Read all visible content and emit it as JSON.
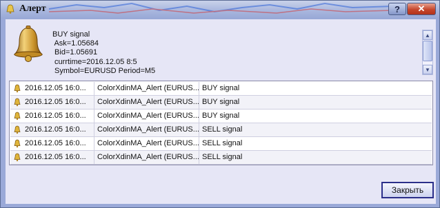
{
  "window": {
    "title": "Алерт",
    "help_label": "?",
    "close_label": "✕"
  },
  "message": {
    "text": "BUY signal\n Ask=1.05684\n Bid=1.05691\n currtime=2016.12.05 8:5\n Symbol=EURUSD Period=M5"
  },
  "alerts": [
    {
      "time": "2016.12.05 16:0...",
      "name": "ColorXdinMA_Alert (EURUS...",
      "message": "BUY signal"
    },
    {
      "time": "2016.12.05 16:0...",
      "name": "ColorXdinMA_Alert (EURUS...",
      "message": "BUY signal"
    },
    {
      "time": "2016.12.05 16:0...",
      "name": "ColorXdinMA_Alert (EURUS...",
      "message": "BUY signal"
    },
    {
      "time": "2016.12.05 16:0...",
      "name": "ColorXdinMA_Alert (EURUS...",
      "message": "SELL signal"
    },
    {
      "time": "2016.12.05 16:0...",
      "name": "ColorXdinMA_Alert (EURUS...",
      "message": "SELL signal"
    },
    {
      "time": "2016.12.05 16:0...",
      "name": "ColorXdinMA_Alert (EURUS...",
      "message": "SELL signal"
    }
  ],
  "buttons": {
    "close_label": "Закрыть"
  },
  "colors": {
    "title_bar": "#a9b7de",
    "close_button": "#c6462c",
    "client_bg": "#e6e6f6"
  }
}
